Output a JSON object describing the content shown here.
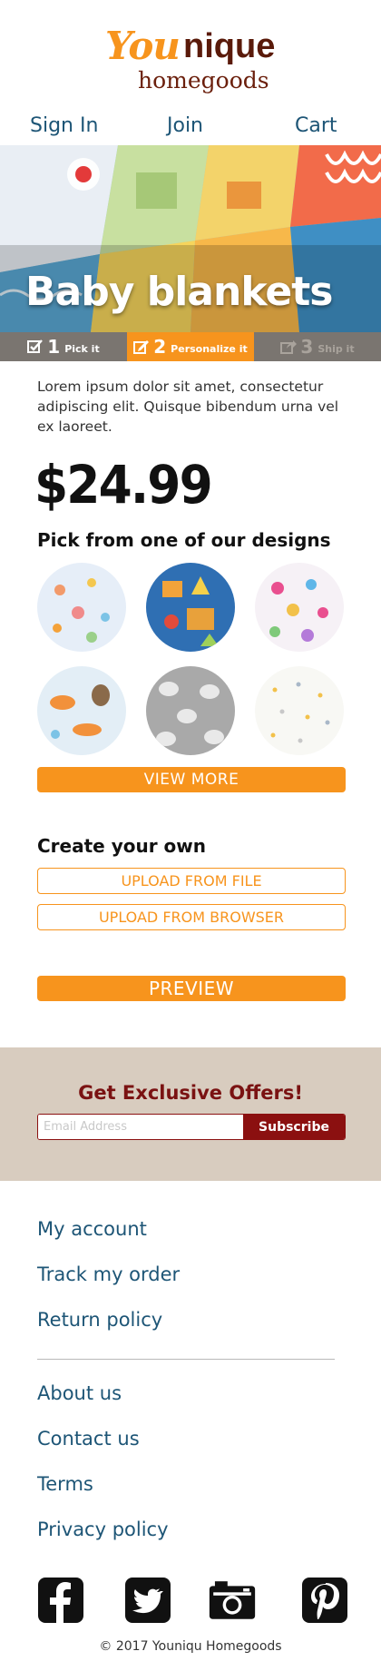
{
  "brand": {
    "logo_part1": "You",
    "logo_part2": "nique",
    "logo_sub": "homegoods",
    "orange": "#f7941d",
    "maroon": "#8b1010",
    "link_blue": "#1d5576"
  },
  "nav": {
    "sign_in": "Sign In",
    "join": "Join",
    "cart": "Cart"
  },
  "hero": {
    "title": "Baby blankets"
  },
  "steps": [
    {
      "num": "1",
      "label": "Pick it",
      "icon": "checkbox-icon",
      "state": "done"
    },
    {
      "num": "2",
      "label": "Personalize it",
      "icon": "edit-icon",
      "state": "active"
    },
    {
      "num": "3",
      "label": "Ship it",
      "icon": "share-icon",
      "state": "upcoming"
    }
  ],
  "product": {
    "description": "Lorem ipsum dolor sit amet, consectetur adipiscing elit. Quisque bibendum urna vel ex laoreet.",
    "price": "$24.99"
  },
  "designs": {
    "heading": "Pick from one of our designs",
    "swatches": [
      "floral-pastel",
      "dinosaur-navy",
      "floral-pink",
      "animals-pastel",
      "elephants-grey",
      "confetti-white"
    ],
    "view_more": "VIEW MORE"
  },
  "create": {
    "heading": "Create your own",
    "upload_file": "UPLOAD FROM FILE",
    "upload_browser": "UPLOAD FROM BROWSER",
    "preview": "PREVIEW"
  },
  "offers": {
    "title": "Get Exclusive Offers!",
    "email_placeholder": "Email Address",
    "subscribe": "Subscribe"
  },
  "footer": {
    "links_group1": [
      "My account",
      "Track my order",
      "Return policy"
    ],
    "links_group2": [
      "About us",
      "Contact us",
      "Terms",
      "Privacy policy"
    ],
    "social": [
      "facebook-icon",
      "twitter-icon",
      "instagram-icon",
      "pinterest-icon"
    ],
    "copyright": "© 2017 Youniqu Homegoods"
  }
}
